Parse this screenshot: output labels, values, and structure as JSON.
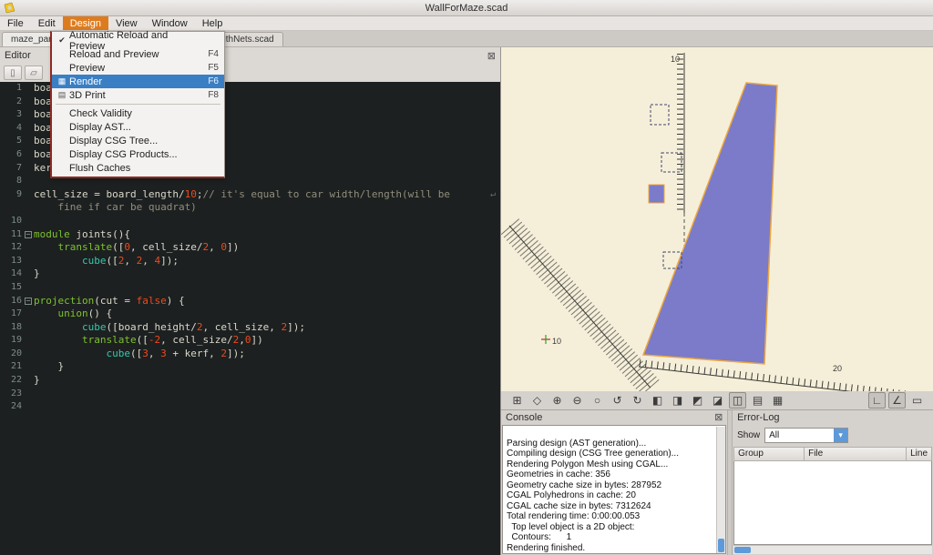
{
  "colors": {
    "accent_orange": "#dd7c1f",
    "menu_highlight": "#3a7fc4",
    "object_fill": "#7b7bca",
    "object_edge": "#edа73f",
    "viewport_bg": "#f5efda",
    "editor_bg": "#1d2020",
    "scroll_thumb": "#5e9ad9"
  },
  "icons": {
    "close": "⊠",
    "check": "✔",
    "wrap": "↵",
    "fold": "−",
    "select_arrow": "▾"
  },
  "titlebar": {
    "title": "WallForMaze.scad"
  },
  "menubar": {
    "items": [
      "File",
      "Edit",
      "Design",
      "View",
      "Window",
      "Help"
    ],
    "active": "Design"
  },
  "design_menu": {
    "items": [
      {
        "label": "Automatic Reload and Preview",
        "checked": true
      },
      {
        "label": "Reload and Preview",
        "shortcut": "F4"
      },
      {
        "label": "Preview",
        "shortcut": "F5"
      },
      {
        "label": "Render",
        "shortcut": "F6",
        "highlighted": true,
        "icon": "render-icon",
        "glyph": "▦"
      },
      {
        "label": "3D Print",
        "shortcut": "F8",
        "icon": "print-icon",
        "glyph": "▤"
      },
      {
        "separator": true
      },
      {
        "label": "Check Validity"
      },
      {
        "label": "Display AST..."
      },
      {
        "label": "Display CSG Tree..."
      },
      {
        "label": "Display CSG Products..."
      },
      {
        "label": "Flush Caches"
      }
    ]
  },
  "tabs": [
    {
      "label": "maze_part...",
      "active": true
    },
    {
      "label": "...WithNets.scad",
      "active": false
    }
  ],
  "editor": {
    "title": "Editor",
    "toolbar_icons": [
      {
        "name": "new-file-icon",
        "glyph": "▯"
      },
      {
        "name": "open-file-icon",
        "glyph": "▱"
      }
    ],
    "rows": [
      {
        "n": "1",
        "t": [
          [
            "boa",
            "d"
          ]
        ]
      },
      {
        "n": "2",
        "t": [
          [
            "boa",
            "d"
          ]
        ]
      },
      {
        "n": "3",
        "t": [
          [
            "boa",
            "d"
          ]
        ]
      },
      {
        "n": "4",
        "t": [
          [
            "boa",
            "d"
          ]
        ]
      },
      {
        "n": "5",
        "t": [
          [
            "boa",
            "d"
          ]
        ]
      },
      {
        "n": "6",
        "t": [
          [
            "boa",
            "d"
          ]
        ]
      },
      {
        "n": "7",
        "t": [
          [
            "ker",
            "d"
          ]
        ]
      },
      {
        "n": "8",
        "t": []
      },
      {
        "n": "9",
        "wrap": true,
        "t": [
          [
            "cell_size = board_length/",
            "d"
          ],
          [
            "10",
            "n"
          ],
          [
            ";",
            "d"
          ],
          [
            "// it's equal to car width/length(will be",
            "c"
          ]
        ]
      },
      {
        "n": "",
        "t": [
          [
            "    fine if car be quadrat)",
            "c"
          ]
        ]
      },
      {
        "n": "10",
        "t": []
      },
      {
        "n": "11",
        "fold": true,
        "t": [
          [
            "module",
            "k"
          ],
          [
            " joints(){",
            "d"
          ]
        ]
      },
      {
        "n": "12",
        "t": [
          [
            "    ",
            "d"
          ],
          [
            "translate",
            "k"
          ],
          [
            "([",
            "d"
          ],
          [
            "0",
            "n"
          ],
          [
            ", cell_size/",
            "d"
          ],
          [
            "2",
            "n"
          ],
          [
            ", ",
            "d"
          ],
          [
            "0",
            "n"
          ],
          [
            "])",
            "d"
          ]
        ]
      },
      {
        "n": "13",
        "t": [
          [
            "        ",
            "d"
          ],
          [
            "cube",
            "b"
          ],
          [
            "([",
            "d"
          ],
          [
            "2",
            "n"
          ],
          [
            ", ",
            "d"
          ],
          [
            "2",
            "n"
          ],
          [
            ", ",
            "d"
          ],
          [
            "4",
            "n"
          ],
          [
            "]);",
            "d"
          ]
        ]
      },
      {
        "n": "14",
        "t": [
          [
            "}",
            "d"
          ]
        ]
      },
      {
        "n": "15",
        "t": []
      },
      {
        "n": "16",
        "fold": true,
        "t": [
          [
            "projection",
            "k"
          ],
          [
            "(cut = ",
            "d"
          ],
          [
            "false",
            "n"
          ],
          [
            ") {",
            "d"
          ]
        ]
      },
      {
        "n": "17",
        "t": [
          [
            "    ",
            "d"
          ],
          [
            "union",
            "k"
          ],
          [
            "() {",
            "d"
          ]
        ]
      },
      {
        "n": "18",
        "t": [
          [
            "        ",
            "d"
          ],
          [
            "cube",
            "b"
          ],
          [
            "([board_height/",
            "d"
          ],
          [
            "2",
            "n"
          ],
          [
            ", cell_size, ",
            "d"
          ],
          [
            "2",
            "n"
          ],
          [
            "]);",
            "d"
          ]
        ]
      },
      {
        "n": "19",
        "t": [
          [
            "        ",
            "d"
          ],
          [
            "translate",
            "k"
          ],
          [
            "([",
            "d"
          ],
          [
            "-2",
            "n"
          ],
          [
            ", cell_size/",
            "d"
          ],
          [
            "2",
            "n"
          ],
          [
            ",",
            "d"
          ],
          [
            "0",
            "n"
          ],
          [
            "])",
            "d"
          ]
        ]
      },
      {
        "n": "20",
        "t": [
          [
            "            ",
            "d"
          ],
          [
            "cube",
            "b"
          ],
          [
            "([",
            "d"
          ],
          [
            "3",
            "n"
          ],
          [
            ", ",
            "d"
          ],
          [
            "3",
            "n"
          ],
          [
            " + kerf, ",
            "d"
          ],
          [
            "2",
            "n"
          ],
          [
            "]);",
            "d"
          ]
        ]
      },
      {
        "n": "21",
        "t": [
          [
            "    }",
            "d"
          ]
        ]
      },
      {
        "n": "22",
        "t": [
          [
            "}",
            "d"
          ]
        ]
      },
      {
        "n": "23",
        "t": []
      },
      {
        "n": "24",
        "t": []
      }
    ]
  },
  "viewport": {
    "tick_labels": {
      "top": "10",
      "origin": "10",
      "x_axis": "20"
    }
  },
  "view_toolbar": {
    "icons": [
      {
        "name": "view-all-icon",
        "glyph": "⊞"
      },
      {
        "name": "zoom-window-icon",
        "glyph": "◇"
      },
      {
        "name": "zoom-in-icon",
        "glyph": "⊕"
      },
      {
        "name": "zoom-out-icon",
        "glyph": "⊖"
      },
      {
        "name": "zoom-reset-icon",
        "glyph": "○"
      },
      {
        "name": "rotate-ccw-icon",
        "glyph": "↺"
      },
      {
        "name": "rotate-cw-icon",
        "glyph": "↻"
      },
      {
        "name": "view-left-icon",
        "glyph": "◧"
      },
      {
        "name": "view-right-icon",
        "glyph": "◨"
      },
      {
        "name": "view-top-icon",
        "glyph": "◩"
      },
      {
        "name": "view-bottom-icon",
        "glyph": "◪"
      },
      {
        "name": "view-diagonal-icon",
        "glyph": "◫",
        "pressed": true
      },
      {
        "name": "perspective-icon",
        "glyph": "▤"
      },
      {
        "name": "orthogonal-icon",
        "glyph": "▦"
      },
      {
        "name": "measure-distance-icon",
        "glyph": "∟",
        "pressed": true,
        "right": true
      },
      {
        "name": "measure-angle-icon",
        "glyph": "∠",
        "pressed": true,
        "right": true
      },
      {
        "name": "selection-frame-icon",
        "glyph": "▭",
        "right": true
      }
    ]
  },
  "console": {
    "title": "Console",
    "lines": [
      "Parsing design (AST generation)...",
      "Compiling design (CSG Tree generation)...",
      "Rendering Polygon Mesh using CGAL...",
      "Geometries in cache: 356",
      "Geometry cache size in bytes: 287952",
      "CGAL Polyhedrons in cache: 20",
      "CGAL cache size in bytes: 7312624",
      "Total rendering time: 0:00:00.053",
      "  Top level object is a 2D object:",
      "  Contours:      1",
      "Rendering finished."
    ]
  },
  "errorlog": {
    "title": "Error-Log",
    "show_label": "Show",
    "filter_value": "All",
    "columns": [
      "Group",
      "File",
      "Line"
    ]
  }
}
